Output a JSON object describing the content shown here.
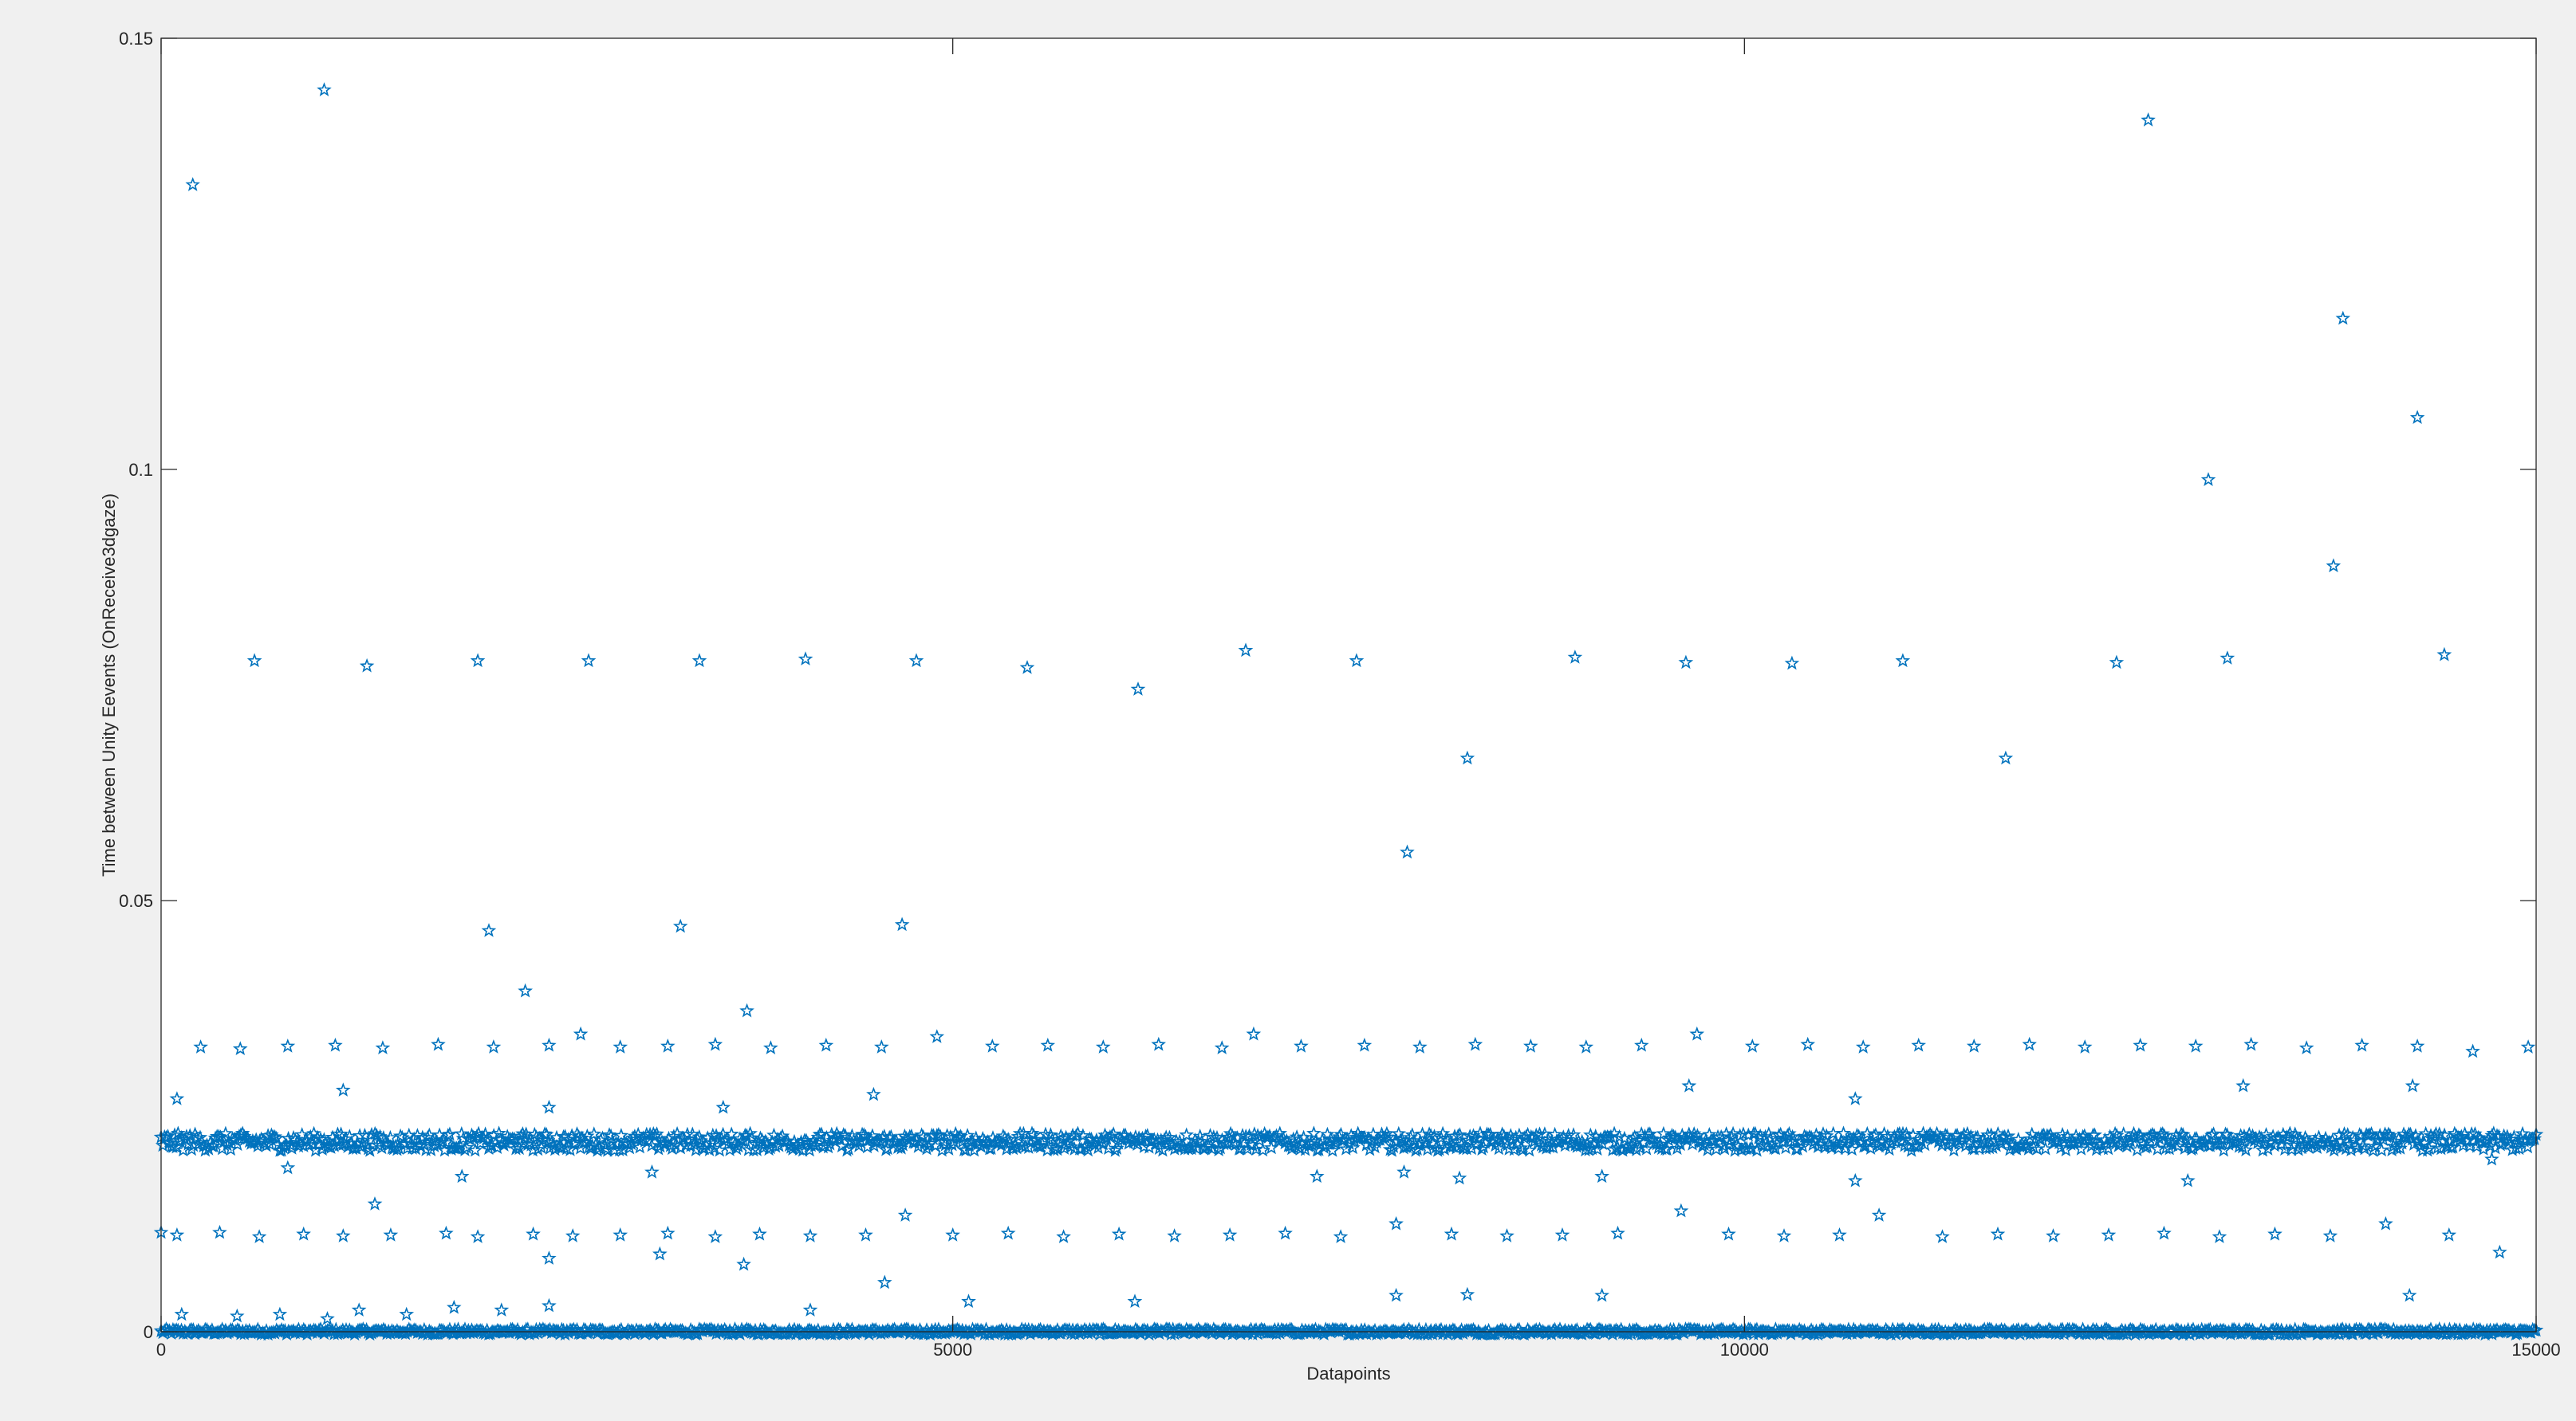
{
  "chart_data": {
    "type": "scatter",
    "title": "",
    "xlabel": "Datapoints",
    "ylabel": "Time between Unity Eevents (OnReceive3dgaze)",
    "xlim": [
      0,
      15000
    ],
    "ylim": [
      0,
      0.15
    ],
    "xticks": [
      0,
      5000,
      10000,
      15000
    ],
    "xtick_labels": [
      "0",
      "5000",
      "10000",
      "15000"
    ],
    "yticks": [
      0,
      0.05,
      0.1,
      0.15
    ],
    "ytick_labels": [
      "0",
      "0.05",
      "0.1",
      "0.15"
    ],
    "grid": false,
    "legend": "none",
    "marker": "pentagram",
    "marker_color": "#0072bd",
    "series": [
      {
        "dense_bands": [
          {
            "x_range": [
              0,
              15000
            ],
            "y_center": 0.0,
            "y_spread": 0.0003
          },
          {
            "x_range": [
              0,
              15000
            ],
            "y_center": 0.022,
            "y_spread": 0.001
          }
        ],
        "points": [
          {
            "x": 200,
            "y": 0.133
          },
          {
            "x": 1030,
            "y": 0.144
          },
          {
            "x": 12550,
            "y": 0.1405
          },
          {
            "x": 13780,
            "y": 0.1175
          },
          {
            "x": 14250,
            "y": 0.106
          },
          {
            "x": 12930,
            "y": 0.0988
          },
          {
            "x": 13720,
            "y": 0.0888
          },
          {
            "x": 14420,
            "y": 0.0785
          },
          {
            "x": 590,
            "y": 0.0778
          },
          {
            "x": 1300,
            "y": 0.0772
          },
          {
            "x": 2000,
            "y": 0.0778
          },
          {
            "x": 2700,
            "y": 0.0778
          },
          {
            "x": 3400,
            "y": 0.0778
          },
          {
            "x": 4070,
            "y": 0.078
          },
          {
            "x": 4770,
            "y": 0.0778
          },
          {
            "x": 5470,
            "y": 0.077
          },
          {
            "x": 6170,
            "y": 0.0745
          },
          {
            "x": 6850,
            "y": 0.079
          },
          {
            "x": 7550,
            "y": 0.0778
          },
          {
            "x": 8930,
            "y": 0.0782
          },
          {
            "x": 9630,
            "y": 0.0776
          },
          {
            "x": 10300,
            "y": 0.0775
          },
          {
            "x": 11000,
            "y": 0.0778
          },
          {
            "x": 12350,
            "y": 0.0776
          },
          {
            "x": 13050,
            "y": 0.0781
          },
          {
            "x": 8250,
            "y": 0.0665
          },
          {
            "x": 11650,
            "y": 0.0665
          },
          {
            "x": 7870,
            "y": 0.0556
          },
          {
            "x": 2070,
            "y": 0.0465
          },
          {
            "x": 3280,
            "y": 0.047
          },
          {
            "x": 4680,
            "y": 0.0472
          },
          {
            "x": 2300,
            "y": 0.0395
          },
          {
            "x": 3700,
            "y": 0.0372
          },
          {
            "x": 250,
            "y": 0.033
          },
          {
            "x": 500,
            "y": 0.0328
          },
          {
            "x": 800,
            "y": 0.0331
          },
          {
            "x": 1100,
            "y": 0.0332
          },
          {
            "x": 1400,
            "y": 0.0329
          },
          {
            "x": 1750,
            "y": 0.0333
          },
          {
            "x": 2100,
            "y": 0.033
          },
          {
            "x": 2450,
            "y": 0.0332
          },
          {
            "x": 2650,
            "y": 0.0345
          },
          {
            "x": 2900,
            "y": 0.033
          },
          {
            "x": 3200,
            "y": 0.0331
          },
          {
            "x": 3500,
            "y": 0.0333
          },
          {
            "x": 3850,
            "y": 0.0329
          },
          {
            "x": 4200,
            "y": 0.0332
          },
          {
            "x": 4550,
            "y": 0.033
          },
          {
            "x": 4900,
            "y": 0.0342
          },
          {
            "x": 5250,
            "y": 0.0331
          },
          {
            "x": 5600,
            "y": 0.0332
          },
          {
            "x": 5950,
            "y": 0.033
          },
          {
            "x": 6300,
            "y": 0.0333
          },
          {
            "x": 6700,
            "y": 0.0329
          },
          {
            "x": 6900,
            "y": 0.0345
          },
          {
            "x": 7200,
            "y": 0.0331
          },
          {
            "x": 7600,
            "y": 0.0332
          },
          {
            "x": 7950,
            "y": 0.033
          },
          {
            "x": 8300,
            "y": 0.0333
          },
          {
            "x": 8650,
            "y": 0.0331
          },
          {
            "x": 9000,
            "y": 0.033
          },
          {
            "x": 9350,
            "y": 0.0332
          },
          {
            "x": 9700,
            "y": 0.0345
          },
          {
            "x": 10050,
            "y": 0.0331
          },
          {
            "x": 10400,
            "y": 0.0333
          },
          {
            "x": 10750,
            "y": 0.033
          },
          {
            "x": 11100,
            "y": 0.0332
          },
          {
            "x": 11450,
            "y": 0.0331
          },
          {
            "x": 11800,
            "y": 0.0333
          },
          {
            "x": 12150,
            "y": 0.033
          },
          {
            "x": 12500,
            "y": 0.0332
          },
          {
            "x": 12850,
            "y": 0.0331
          },
          {
            "x": 13200,
            "y": 0.0333
          },
          {
            "x": 13550,
            "y": 0.0329
          },
          {
            "x": 13900,
            "y": 0.0332
          },
          {
            "x": 14250,
            "y": 0.0331
          },
          {
            "x": 14600,
            "y": 0.0325
          },
          {
            "x": 14950,
            "y": 0.033
          },
          {
            "x": 100,
            "y": 0.027
          },
          {
            "x": 1150,
            "y": 0.028
          },
          {
            "x": 2450,
            "y": 0.026
          },
          {
            "x": 3550,
            "y": 0.026
          },
          {
            "x": 4500,
            "y": 0.0275
          },
          {
            "x": 9650,
            "y": 0.0285
          },
          {
            "x": 10700,
            "y": 0.027
          },
          {
            "x": 13150,
            "y": 0.0285
          },
          {
            "x": 14220,
            "y": 0.0285
          },
          {
            "x": 800,
            "y": 0.019
          },
          {
            "x": 1900,
            "y": 0.018
          },
          {
            "x": 3100,
            "y": 0.0185
          },
          {
            "x": 7300,
            "y": 0.018
          },
          {
            "x": 7850,
            "y": 0.0185
          },
          {
            "x": 8200,
            "y": 0.0178
          },
          {
            "x": 9100,
            "y": 0.018
          },
          {
            "x": 10700,
            "y": 0.0175
          },
          {
            "x": 12800,
            "y": 0.0175
          },
          {
            "x": 14720,
            "y": 0.02
          },
          {
            "x": 0,
            "y": 0.0115
          },
          {
            "x": 100,
            "y": 0.0112
          },
          {
            "x": 370,
            "y": 0.0115
          },
          {
            "x": 620,
            "y": 0.011
          },
          {
            "x": 900,
            "y": 0.0113
          },
          {
            "x": 1150,
            "y": 0.0111
          },
          {
            "x": 1450,
            "y": 0.0112
          },
          {
            "x": 1800,
            "y": 0.0114
          },
          {
            "x": 2000,
            "y": 0.011
          },
          {
            "x": 2350,
            "y": 0.0113
          },
          {
            "x": 2600,
            "y": 0.0111
          },
          {
            "x": 2900,
            "y": 0.0112
          },
          {
            "x": 3200,
            "y": 0.0114
          },
          {
            "x": 3500,
            "y": 0.011
          },
          {
            "x": 3780,
            "y": 0.0113
          },
          {
            "x": 4100,
            "y": 0.0111
          },
          {
            "x": 4450,
            "y": 0.0112
          },
          {
            "x": 4700,
            "y": 0.0135
          },
          {
            "x": 5000,
            "y": 0.0112
          },
          {
            "x": 5350,
            "y": 0.0114
          },
          {
            "x": 5700,
            "y": 0.011
          },
          {
            "x": 6050,
            "y": 0.0113
          },
          {
            "x": 6400,
            "y": 0.0111
          },
          {
            "x": 6750,
            "y": 0.0112
          },
          {
            "x": 7100,
            "y": 0.0114
          },
          {
            "x": 7450,
            "y": 0.011
          },
          {
            "x": 7800,
            "y": 0.0125
          },
          {
            "x": 8150,
            "y": 0.0113
          },
          {
            "x": 8500,
            "y": 0.0111
          },
          {
            "x": 8850,
            "y": 0.0112
          },
          {
            "x": 9200,
            "y": 0.0114
          },
          {
            "x": 9600,
            "y": 0.014
          },
          {
            "x": 9900,
            "y": 0.0113
          },
          {
            "x": 10250,
            "y": 0.0111
          },
          {
            "x": 10600,
            "y": 0.0112
          },
          {
            "x": 10850,
            "y": 0.0135
          },
          {
            "x": 11250,
            "y": 0.011
          },
          {
            "x": 11600,
            "y": 0.0113
          },
          {
            "x": 11950,
            "y": 0.0111
          },
          {
            "x": 12300,
            "y": 0.0112
          },
          {
            "x": 12650,
            "y": 0.0114
          },
          {
            "x": 13000,
            "y": 0.011
          },
          {
            "x": 13350,
            "y": 0.0113
          },
          {
            "x": 13700,
            "y": 0.0111
          },
          {
            "x": 14050,
            "y": 0.0125
          },
          {
            "x": 14450,
            "y": 0.0112
          },
          {
            "x": 14770,
            "y": 0.0092
          },
          {
            "x": 1350,
            "y": 0.0148
          },
          {
            "x": 2450,
            "y": 0.0085
          },
          {
            "x": 3150,
            "y": 0.009
          },
          {
            "x": 3680,
            "y": 0.0078
          },
          {
            "x": 4570,
            "y": 0.0057
          },
          {
            "x": 130,
            "y": 0.002
          },
          {
            "x": 480,
            "y": 0.0018
          },
          {
            "x": 750,
            "y": 0.002
          },
          {
            "x": 1050,
            "y": 0.0015
          },
          {
            "x": 1250,
            "y": 0.0025
          },
          {
            "x": 1550,
            "y": 0.002
          },
          {
            "x": 1850,
            "y": 0.0028
          },
          {
            "x": 2150,
            "y": 0.0025
          },
          {
            "x": 2450,
            "y": 0.003
          },
          {
            "x": 4100,
            "y": 0.0025
          },
          {
            "x": 5100,
            "y": 0.0035
          },
          {
            "x": 6150,
            "y": 0.0035
          },
          {
            "x": 7800,
            "y": 0.0042
          },
          {
            "x": 8250,
            "y": 0.0043
          },
          {
            "x": 9100,
            "y": 0.0042
          },
          {
            "x": 14200,
            "y": 0.0042
          }
        ]
      }
    ]
  }
}
